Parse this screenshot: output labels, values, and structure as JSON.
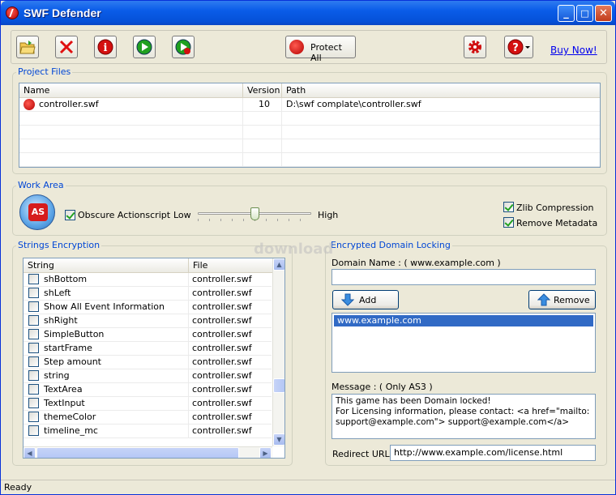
{
  "window": {
    "title": "SWF Defender",
    "minimize": "_",
    "maximize": "□",
    "close": "✕"
  },
  "toolbar": {
    "buttons": [
      {
        "icon": "open-folder-icon",
        "glyph": "📂",
        "color": "#2e8b2e"
      },
      {
        "icon": "delete-icon",
        "glyph": "✕",
        "color": "#d00000"
      },
      {
        "icon": "info-icon",
        "glyph": "i",
        "color": "#c00000"
      },
      {
        "icon": "play-icon",
        "glyph": "▶",
        "color": "#1a9a1a"
      },
      {
        "icon": "play-in-browser-icon",
        "glyph": "▶",
        "color": "#1a9a1a"
      }
    ],
    "protect_label": "Protect All",
    "buy_label": "Buy Now!"
  },
  "project_files": {
    "legend": "Project Files",
    "columns": [
      "Name",
      "Version",
      "Path"
    ],
    "rows": [
      {
        "name": "controller.swf",
        "version": "10",
        "path": "D:\\swf complate\\controller.swf"
      }
    ]
  },
  "work_area": {
    "legend": "Work Area",
    "as_badge": "AS",
    "obscure_label": "Obscure Actionscript",
    "low_label": "Low",
    "high_label": "High",
    "slider_value": 0.5,
    "zlib_label": "Zlib Compression",
    "remove_meta_label": "Remove Metadata"
  },
  "strings": {
    "legend": "Strings Encryption",
    "columns": [
      "String",
      "File"
    ],
    "rows": [
      {
        "string": "shBottom",
        "file": "controller.swf"
      },
      {
        "string": "shLeft",
        "file": "controller.swf"
      },
      {
        "string": "Show All Event Information",
        "file": "controller.swf"
      },
      {
        "string": "shRight",
        "file": "controller.swf"
      },
      {
        "string": "SimpleButton",
        "file": "controller.swf"
      },
      {
        "string": "startFrame",
        "file": "controller.swf"
      },
      {
        "string": "Step amount",
        "file": "controller.swf"
      },
      {
        "string": "string",
        "file": "controller.swf"
      },
      {
        "string": "TextArea",
        "file": "controller.swf"
      },
      {
        "string": "TextInput",
        "file": "controller.swf"
      },
      {
        "string": "themeColor",
        "file": "controller.swf"
      },
      {
        "string": "timeline_mc",
        "file": "controller.swf"
      }
    ]
  },
  "domain": {
    "legend": "Encrypted Domain Locking",
    "domain_label": "Domain Name :  ( www.example.com )",
    "domain_value": "",
    "add_label": "Add",
    "remove_label": "Remove",
    "domains": [
      "www.example.com"
    ],
    "message_label": "Message : ( Only AS3 )",
    "message": "This game has been Domain locked!\nFor Licensing information, please contact: <a href=\"mailto:\nsupport@example.com\"> support@example.com</a>",
    "redirect_label": "Redirect URL:",
    "redirect_value": "http://www.example.com/license.html"
  },
  "watermark": "download",
  "status": {
    "text": "Ready"
  }
}
